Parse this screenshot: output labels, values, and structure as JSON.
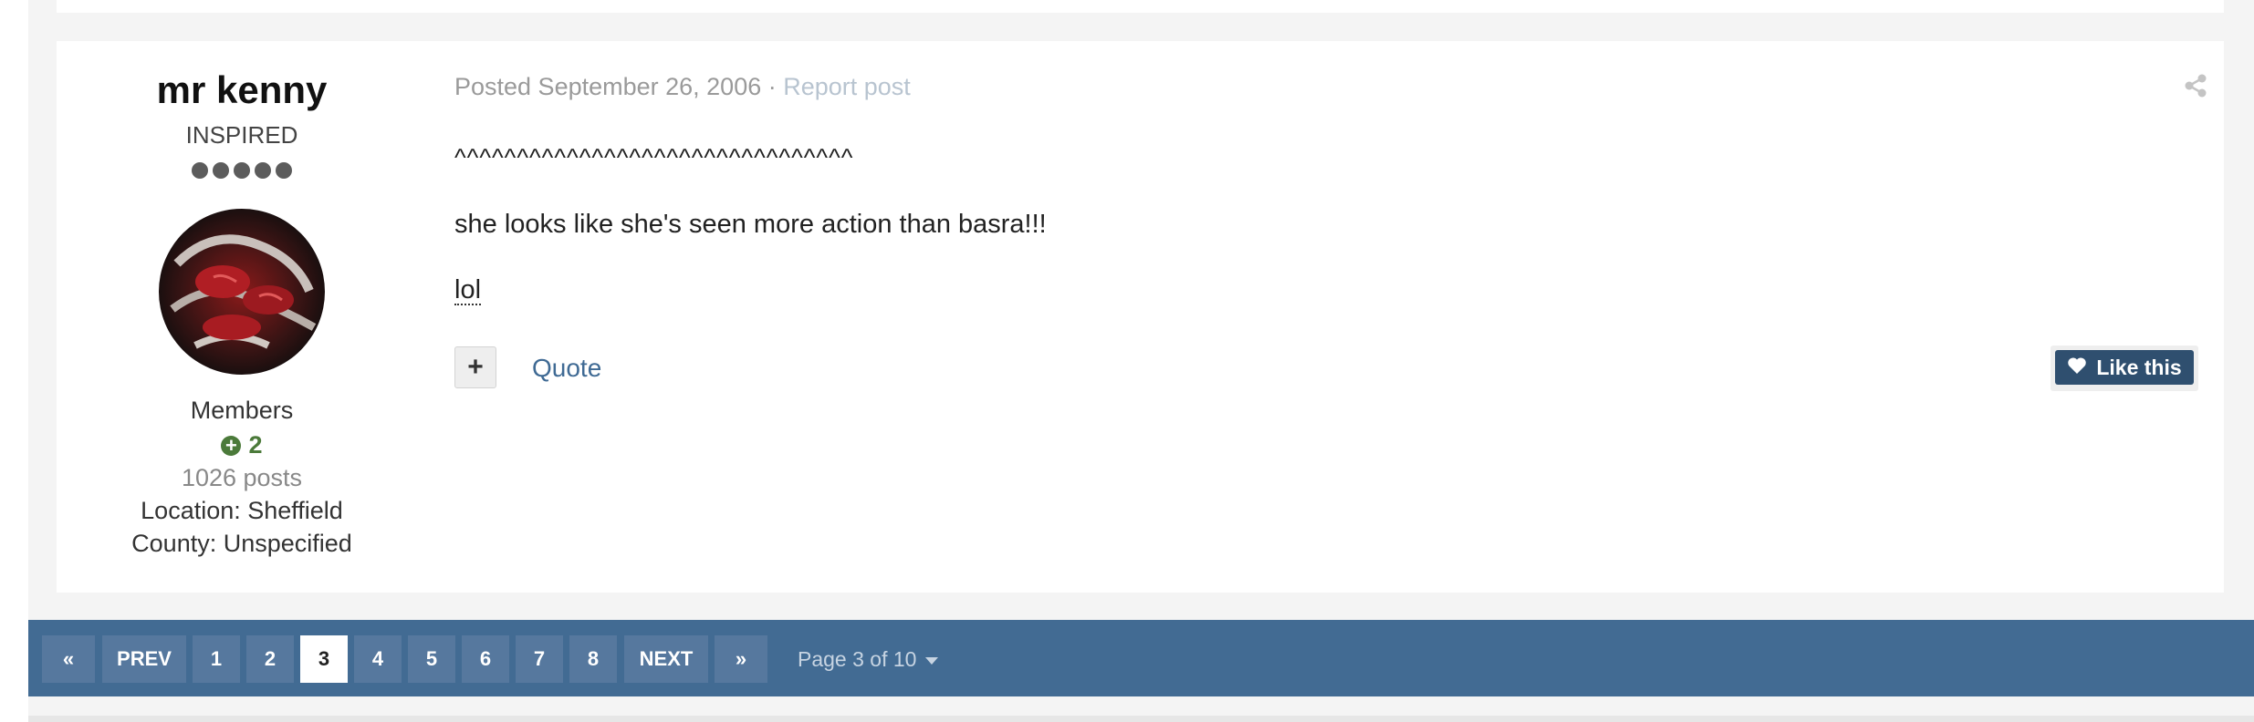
{
  "post": {
    "author": {
      "name": "mr kenny",
      "rank_title": "INSPIRED",
      "rank_pips": 5,
      "group": "Members",
      "reputation": "2",
      "posts": "1026 posts",
      "location": "Location: Sheffield",
      "county": "County: Unspecified"
    },
    "meta": {
      "posted": "Posted September 26, 2006",
      "separator": " · ",
      "report": "Report post"
    },
    "content": {
      "line1": "^^^^^^^^^^^^^^^^^^^^^^^^^^^^^^^^",
      "line2": "she looks like she's seen more action than basra!!!",
      "line3": "lol"
    },
    "actions": {
      "multiquote": "+",
      "quote": "Quote",
      "like": "Like this"
    }
  },
  "pagination": {
    "first": "«",
    "prev": "PREV",
    "pages": [
      "1",
      "2",
      "3",
      "4",
      "5",
      "6",
      "7",
      "8"
    ],
    "current": "3",
    "next": "NEXT",
    "last": "»",
    "page_of": "Page 3 of 10"
  },
  "colors": {
    "pagination_bar": "#426b93",
    "link": "#3f6a94",
    "like_button": "#2f4f6f",
    "reputation": "#4b7a3a"
  }
}
